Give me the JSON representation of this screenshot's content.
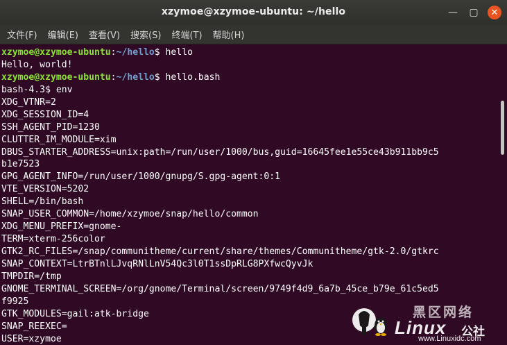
{
  "window": {
    "title": "xzymoe@xzymoe-ubuntu: ~/hello",
    "controls": {
      "minimize_glyph": "—",
      "maximize_glyph": "▢",
      "close_glyph": "✕"
    },
    "colors": {
      "terminal_bg": "#300a24",
      "prompt_user": "#8ae234",
      "prompt_path": "#729fcf",
      "close_button": "#e95420"
    }
  },
  "menubar": {
    "items": [
      {
        "label": "文件(F)"
      },
      {
        "label": "编辑(E)"
      },
      {
        "label": "查看(V)"
      },
      {
        "label": "搜索(S)"
      },
      {
        "label": "终端(T)"
      },
      {
        "label": "帮助(H)"
      }
    ]
  },
  "terminal": {
    "prompt": {
      "user_host": "xzymoe@xzymoe-ubuntu",
      "colon": ":",
      "path": "~/hello",
      "symbol": "$ "
    },
    "lines": [
      {
        "type": "prompt",
        "command": "hello"
      },
      {
        "type": "output",
        "text": "Hello, world!"
      },
      {
        "type": "prompt",
        "command": "hello.bash"
      },
      {
        "type": "output",
        "text": "bash-4.3$ env"
      },
      {
        "type": "output",
        "text": "XDG_VTNR=2"
      },
      {
        "type": "output",
        "text": "XDG_SESSION_ID=4"
      },
      {
        "type": "output",
        "text": "SSH_AGENT_PID=1230"
      },
      {
        "type": "output",
        "text": "CLUTTER_IM_MODULE=xim"
      },
      {
        "type": "output",
        "text": "DBUS_STARTER_ADDRESS=unix:path=/run/user/1000/bus,guid=16645fee1e55ce43b911bb9c5"
      },
      {
        "type": "output",
        "text": "b1e7523"
      },
      {
        "type": "output",
        "text": "GPG_AGENT_INFO=/run/user/1000/gnupg/S.gpg-agent:0:1"
      },
      {
        "type": "output",
        "text": "VTE_VERSION=5202"
      },
      {
        "type": "output",
        "text": "SHELL=/bin/bash"
      },
      {
        "type": "output",
        "text": "SNAP_USER_COMMON=/home/xzymoe/snap/hello/common"
      },
      {
        "type": "output",
        "text": "XDG_MENU_PREFIX=gnome-"
      },
      {
        "type": "output",
        "text": "TERM=xterm-256color"
      },
      {
        "type": "output",
        "text": "GTK2_RC_FILES=/snap/communitheme/current/share/themes/Communitheme/gtk-2.0/gtkrc"
      },
      {
        "type": "output",
        "text": "SNAP_CONTEXT=LtrBTnlLJvqRNlLnV54Qc3l0T1ssDpRLG8PXfwcQyvJk"
      },
      {
        "type": "output",
        "text": "TMPDIR=/tmp"
      },
      {
        "type": "output",
        "text": "GNOME_TERMINAL_SCREEN=/org/gnome/Terminal/screen/9749f4d9_6a7b_45ce_b79e_61c5ed5"
      },
      {
        "type": "output",
        "text": "f9925"
      },
      {
        "type": "output",
        "text": "GTK_MODULES=gail:atk-bridge"
      },
      {
        "type": "output",
        "text": "SNAP_REEXEC="
      },
      {
        "type": "output",
        "text": "USER=xzymoe"
      }
    ]
  },
  "watermark": {
    "top_text": "黑区网络",
    "brand": "Linux",
    "brand_cn": "公社",
    "url": "www.Linuxidc.com"
  }
}
